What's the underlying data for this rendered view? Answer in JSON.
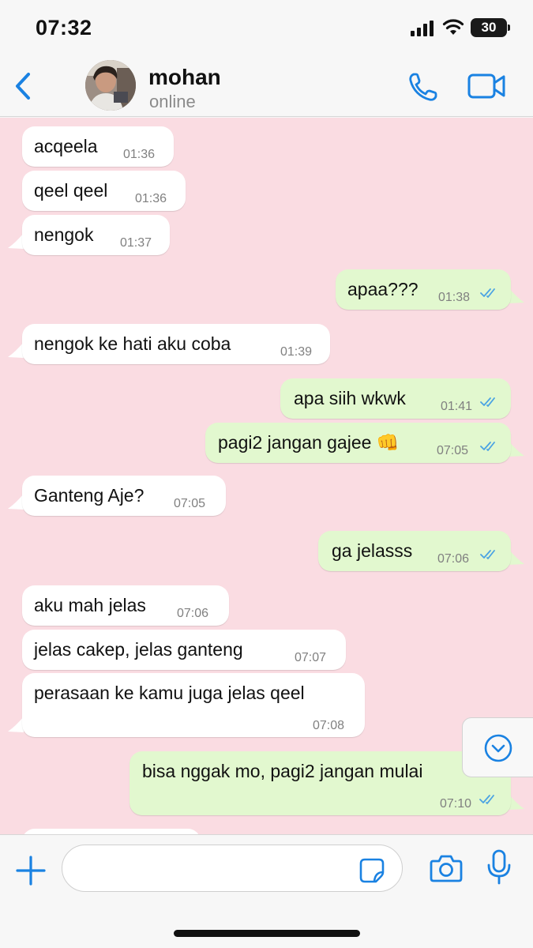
{
  "status_bar": {
    "time": "07:32",
    "battery": "30"
  },
  "header": {
    "contact_name": "mohan",
    "contact_status": "online"
  },
  "messages": [
    {
      "direction": "in",
      "text": "acqeela",
      "time": "01:36"
    },
    {
      "direction": "in",
      "text": "qeel qeel",
      "time": "01:36"
    },
    {
      "direction": "in",
      "text": "nengok",
      "time": "01:37"
    },
    {
      "direction": "out",
      "text": "apaa???",
      "time": "01:38",
      "status": "read"
    },
    {
      "direction": "in",
      "text": "nengok ke hati aku coba",
      "time": "01:39"
    },
    {
      "direction": "out",
      "text": "apa siih wkwk",
      "time": "01:41",
      "status": "read"
    },
    {
      "direction": "out",
      "text": "pagi2 jangan gajee 👊",
      "time": "07:05",
      "status": "read"
    },
    {
      "direction": "in",
      "text": "Ganteng Aje?",
      "time": "07:05"
    },
    {
      "direction": "out",
      "text": "ga jelasss",
      "time": "07:06",
      "status": "read"
    },
    {
      "direction": "in",
      "text": "aku mah jelas",
      "time": "07:06"
    },
    {
      "direction": "in",
      "text": "jelas cakep, jelas ganteng",
      "time": "07:07"
    },
    {
      "direction": "in",
      "text": "perasaan ke kamu juga jelas qeel",
      "time": "07:08"
    },
    {
      "direction": "out",
      "text": "bisa nggak mo, pagi2 jangan mulai",
      "time": "07:10",
      "status": "read"
    }
  ],
  "colors": {
    "chat_background": "#fadce2",
    "incoming_bubble": "#ffffff",
    "outgoing_bubble": "#e2f8cf",
    "accent": "#1a82e2",
    "read_ticks": "#4ba3e3"
  },
  "icons": {
    "back": "chevron-left-icon",
    "call": "phone-icon",
    "video": "video-camera-icon",
    "attach": "plus-icon",
    "sticker": "sticker-icon",
    "camera": "camera-icon",
    "mic": "microphone-icon",
    "scroll_down": "chevron-down-circle-icon"
  }
}
